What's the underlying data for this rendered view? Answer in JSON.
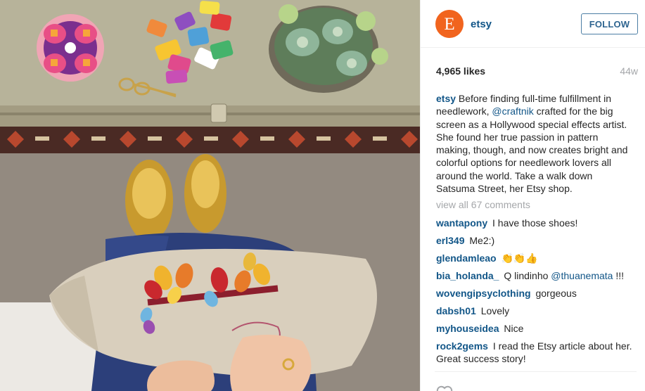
{
  "photo": {
    "description_icon": "embroidery-photo"
  },
  "header": {
    "avatar_letter": "E",
    "username": "etsy",
    "follow_label": "FOLLOW"
  },
  "stats": {
    "likes": "4,965 likes",
    "age": "44w"
  },
  "caption": {
    "user": "etsy",
    "part1": " Before finding full-time fulfillment in needlework, ",
    "mention": "@craftnik",
    "part2": " crafted for the big screen as a Hollywood special effects artist. She found her true passion in pattern making, though, and now creates bright and colorful options for needlework lovers all around the world. Take a walk down Satsuma Street, her Etsy shop."
  },
  "view_all": "view all 67 comments",
  "comments": [
    {
      "user": "wantapony",
      "text": "I have those shoes!"
    },
    {
      "user": "erl349",
      "text": "Me2:)"
    },
    {
      "user": "glendamleao",
      "text": "👏👏👍"
    },
    {
      "user": "bia_holanda_",
      "text": "Q lindinho ",
      "mention": "@thuanemata",
      "tail": " !!!"
    },
    {
      "user": "wovengipsyclothing",
      "text": "gorgeous"
    },
    {
      "user": "dabsh01",
      "text": "Lovely"
    },
    {
      "user": "myhouseidea",
      "text": "Nice"
    },
    {
      "user": "rock2gems",
      "text": "I read the Etsy article about her. Great success story!"
    }
  ],
  "colors": {
    "link": "#125688",
    "brand": "#f1641e",
    "muted": "#a5a7aa"
  }
}
